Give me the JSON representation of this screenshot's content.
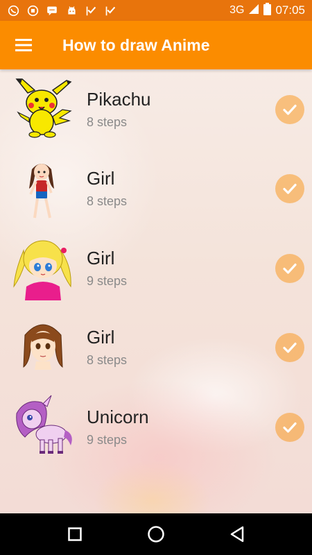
{
  "status_bar": {
    "network": "3G",
    "time": "07:05",
    "notification_icons": [
      "whatsapp-icon",
      "vpn-icon",
      "message-icon",
      "android-icon",
      "check-flag-icon",
      "check-flag-icon"
    ]
  },
  "app_bar": {
    "title": "How to draw Anime"
  },
  "items": [
    {
      "title": "Pikachu",
      "subtitle": "8 steps",
      "thumb": "pikachu-thumbnail"
    },
    {
      "title": "Girl",
      "subtitle": "8 steps",
      "thumb": "girl-thumbnail"
    },
    {
      "title": "Girl",
      "subtitle": "9 steps",
      "thumb": "blonde-girl-thumbnail"
    },
    {
      "title": "Girl",
      "subtitle": "8 steps",
      "thumb": "brown-hair-girl-thumbnail"
    },
    {
      "title": "Unicorn",
      "subtitle": "9 steps",
      "thumb": "unicorn-thumbnail"
    }
  ],
  "colors": {
    "status_bar": "#e8740c",
    "app_bar": "#fb8c00",
    "check_badge": "#fb8c00"
  }
}
